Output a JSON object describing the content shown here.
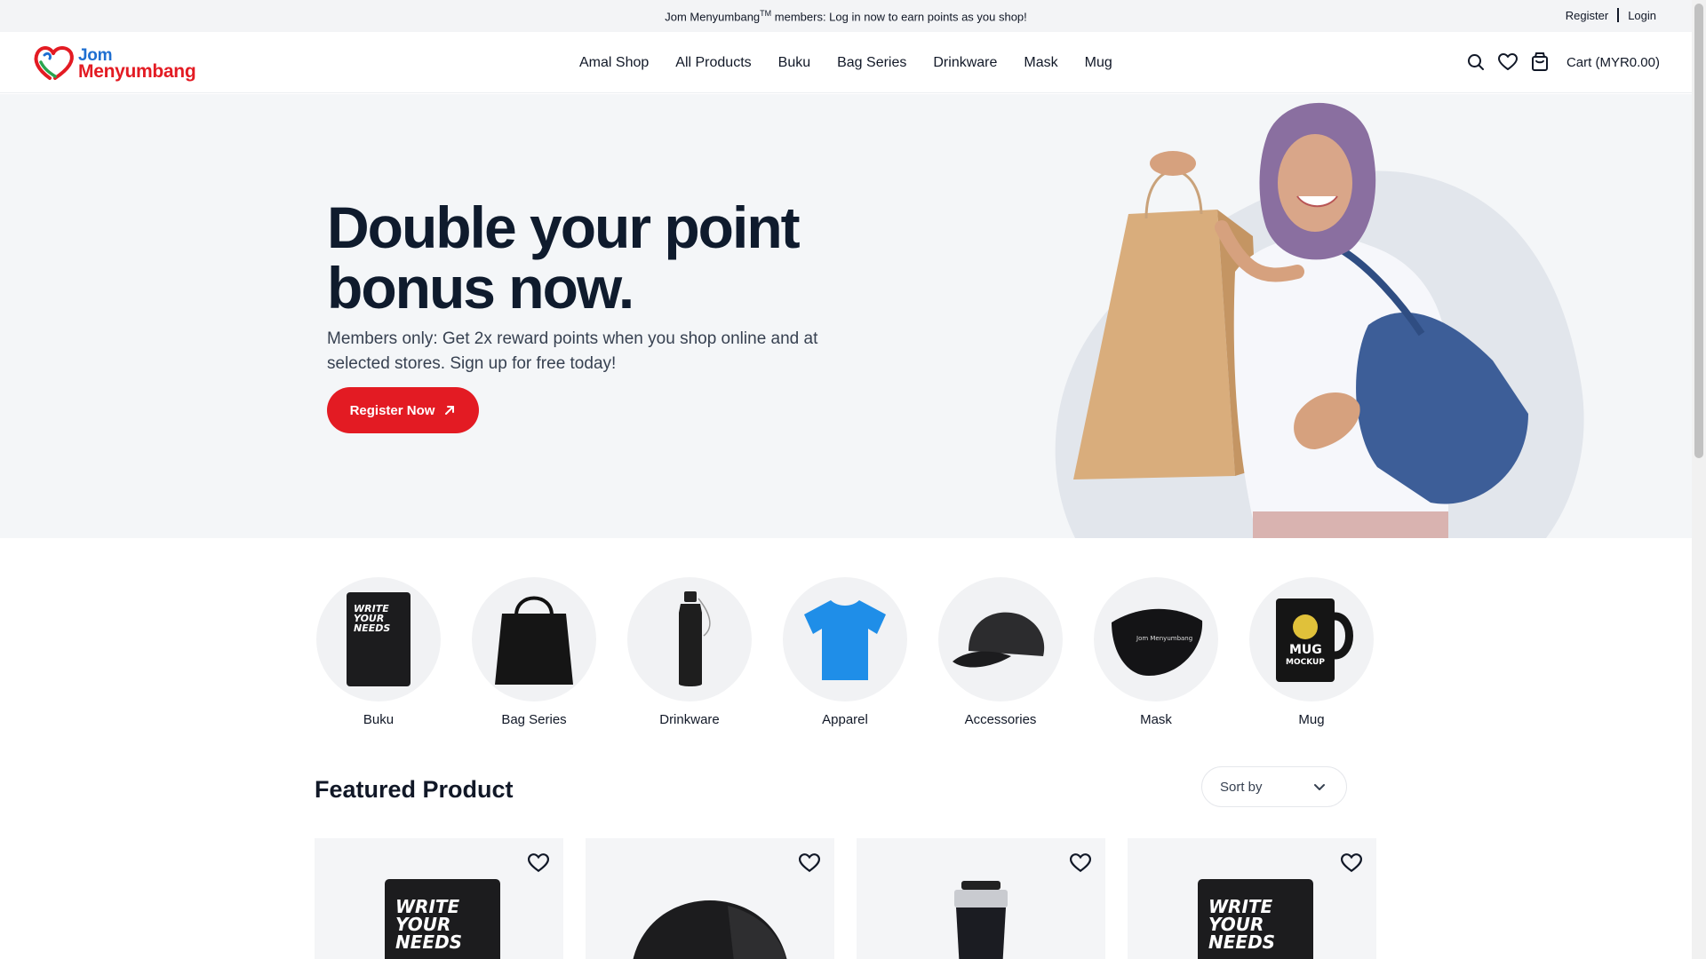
{
  "announcement": {
    "text_pre": "Jom Menyumbang",
    "text_sup": "TM",
    "text_post": " members: Log in now to earn points as you shop!",
    "register": "Register",
    "login": "Login"
  },
  "brand": {
    "line1": "Jom",
    "line2": "Menyumbang",
    "primary_color": "#e31b23",
    "secondary_color": "#1f6fd1"
  },
  "nav": [
    "Amal Shop",
    "All Products",
    "Buku",
    "Bag Series",
    "Drinkware",
    "Mask",
    "Mug"
  ],
  "header": {
    "cart_label": "Cart (MYR0.00)",
    "icons": [
      "search-icon",
      "heart-icon",
      "cart-icon"
    ]
  },
  "hero": {
    "title_line1": "Double your point",
    "title_line2": "bonus now.",
    "subtitle": "Members only: Get 2x reward points when you shop online and at selected stores. Sign up for free today!",
    "button": "Register Now"
  },
  "categories": [
    "Buku",
    "Bag Series",
    "Drinkware",
    "Apparel",
    "Accessories",
    "Mask",
    "Mug"
  ],
  "featured": {
    "title": "Featured Product",
    "sort_label": "Sort by"
  },
  "product_images": {
    "notebook": [
      "WRITE",
      "YOUR",
      "NEEDS"
    ],
    "mug": [
      "MUG",
      "MOCKUP"
    ],
    "mask_brand": "Jom Menyumbang"
  }
}
